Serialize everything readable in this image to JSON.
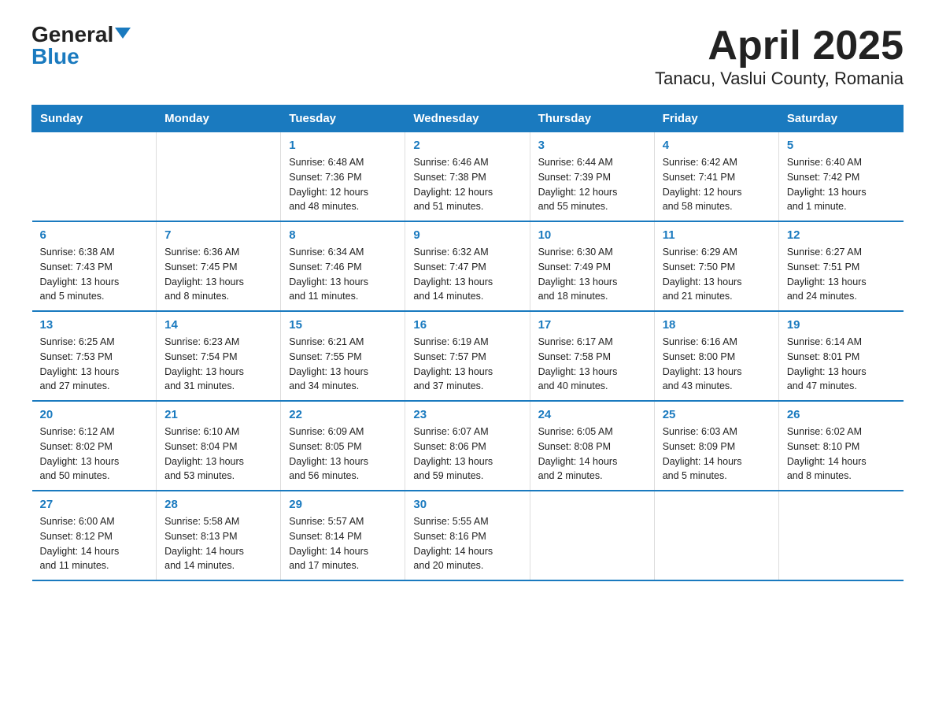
{
  "header": {
    "logo_general": "General",
    "logo_blue": "Blue",
    "title": "April 2025",
    "subtitle": "Tanacu, Vaslui County, Romania"
  },
  "weekdays": [
    "Sunday",
    "Monday",
    "Tuesday",
    "Wednesday",
    "Thursday",
    "Friday",
    "Saturday"
  ],
  "weeks": [
    [
      {
        "day": "",
        "info": ""
      },
      {
        "day": "",
        "info": ""
      },
      {
        "day": "1",
        "info": "Sunrise: 6:48 AM\nSunset: 7:36 PM\nDaylight: 12 hours\nand 48 minutes."
      },
      {
        "day": "2",
        "info": "Sunrise: 6:46 AM\nSunset: 7:38 PM\nDaylight: 12 hours\nand 51 minutes."
      },
      {
        "day": "3",
        "info": "Sunrise: 6:44 AM\nSunset: 7:39 PM\nDaylight: 12 hours\nand 55 minutes."
      },
      {
        "day": "4",
        "info": "Sunrise: 6:42 AM\nSunset: 7:41 PM\nDaylight: 12 hours\nand 58 minutes."
      },
      {
        "day": "5",
        "info": "Sunrise: 6:40 AM\nSunset: 7:42 PM\nDaylight: 13 hours\nand 1 minute."
      }
    ],
    [
      {
        "day": "6",
        "info": "Sunrise: 6:38 AM\nSunset: 7:43 PM\nDaylight: 13 hours\nand 5 minutes."
      },
      {
        "day": "7",
        "info": "Sunrise: 6:36 AM\nSunset: 7:45 PM\nDaylight: 13 hours\nand 8 minutes."
      },
      {
        "day": "8",
        "info": "Sunrise: 6:34 AM\nSunset: 7:46 PM\nDaylight: 13 hours\nand 11 minutes."
      },
      {
        "day": "9",
        "info": "Sunrise: 6:32 AM\nSunset: 7:47 PM\nDaylight: 13 hours\nand 14 minutes."
      },
      {
        "day": "10",
        "info": "Sunrise: 6:30 AM\nSunset: 7:49 PM\nDaylight: 13 hours\nand 18 minutes."
      },
      {
        "day": "11",
        "info": "Sunrise: 6:29 AM\nSunset: 7:50 PM\nDaylight: 13 hours\nand 21 minutes."
      },
      {
        "day": "12",
        "info": "Sunrise: 6:27 AM\nSunset: 7:51 PM\nDaylight: 13 hours\nand 24 minutes."
      }
    ],
    [
      {
        "day": "13",
        "info": "Sunrise: 6:25 AM\nSunset: 7:53 PM\nDaylight: 13 hours\nand 27 minutes."
      },
      {
        "day": "14",
        "info": "Sunrise: 6:23 AM\nSunset: 7:54 PM\nDaylight: 13 hours\nand 31 minutes."
      },
      {
        "day": "15",
        "info": "Sunrise: 6:21 AM\nSunset: 7:55 PM\nDaylight: 13 hours\nand 34 minutes."
      },
      {
        "day": "16",
        "info": "Sunrise: 6:19 AM\nSunset: 7:57 PM\nDaylight: 13 hours\nand 37 minutes."
      },
      {
        "day": "17",
        "info": "Sunrise: 6:17 AM\nSunset: 7:58 PM\nDaylight: 13 hours\nand 40 minutes."
      },
      {
        "day": "18",
        "info": "Sunrise: 6:16 AM\nSunset: 8:00 PM\nDaylight: 13 hours\nand 43 minutes."
      },
      {
        "day": "19",
        "info": "Sunrise: 6:14 AM\nSunset: 8:01 PM\nDaylight: 13 hours\nand 47 minutes."
      }
    ],
    [
      {
        "day": "20",
        "info": "Sunrise: 6:12 AM\nSunset: 8:02 PM\nDaylight: 13 hours\nand 50 minutes."
      },
      {
        "day": "21",
        "info": "Sunrise: 6:10 AM\nSunset: 8:04 PM\nDaylight: 13 hours\nand 53 minutes."
      },
      {
        "day": "22",
        "info": "Sunrise: 6:09 AM\nSunset: 8:05 PM\nDaylight: 13 hours\nand 56 minutes."
      },
      {
        "day": "23",
        "info": "Sunrise: 6:07 AM\nSunset: 8:06 PM\nDaylight: 13 hours\nand 59 minutes."
      },
      {
        "day": "24",
        "info": "Sunrise: 6:05 AM\nSunset: 8:08 PM\nDaylight: 14 hours\nand 2 minutes."
      },
      {
        "day": "25",
        "info": "Sunrise: 6:03 AM\nSunset: 8:09 PM\nDaylight: 14 hours\nand 5 minutes."
      },
      {
        "day": "26",
        "info": "Sunrise: 6:02 AM\nSunset: 8:10 PM\nDaylight: 14 hours\nand 8 minutes."
      }
    ],
    [
      {
        "day": "27",
        "info": "Sunrise: 6:00 AM\nSunset: 8:12 PM\nDaylight: 14 hours\nand 11 minutes."
      },
      {
        "day": "28",
        "info": "Sunrise: 5:58 AM\nSunset: 8:13 PM\nDaylight: 14 hours\nand 14 minutes."
      },
      {
        "day": "29",
        "info": "Sunrise: 5:57 AM\nSunset: 8:14 PM\nDaylight: 14 hours\nand 17 minutes."
      },
      {
        "day": "30",
        "info": "Sunrise: 5:55 AM\nSunset: 8:16 PM\nDaylight: 14 hours\nand 20 minutes."
      },
      {
        "day": "",
        "info": ""
      },
      {
        "day": "",
        "info": ""
      },
      {
        "day": "",
        "info": ""
      }
    ]
  ]
}
